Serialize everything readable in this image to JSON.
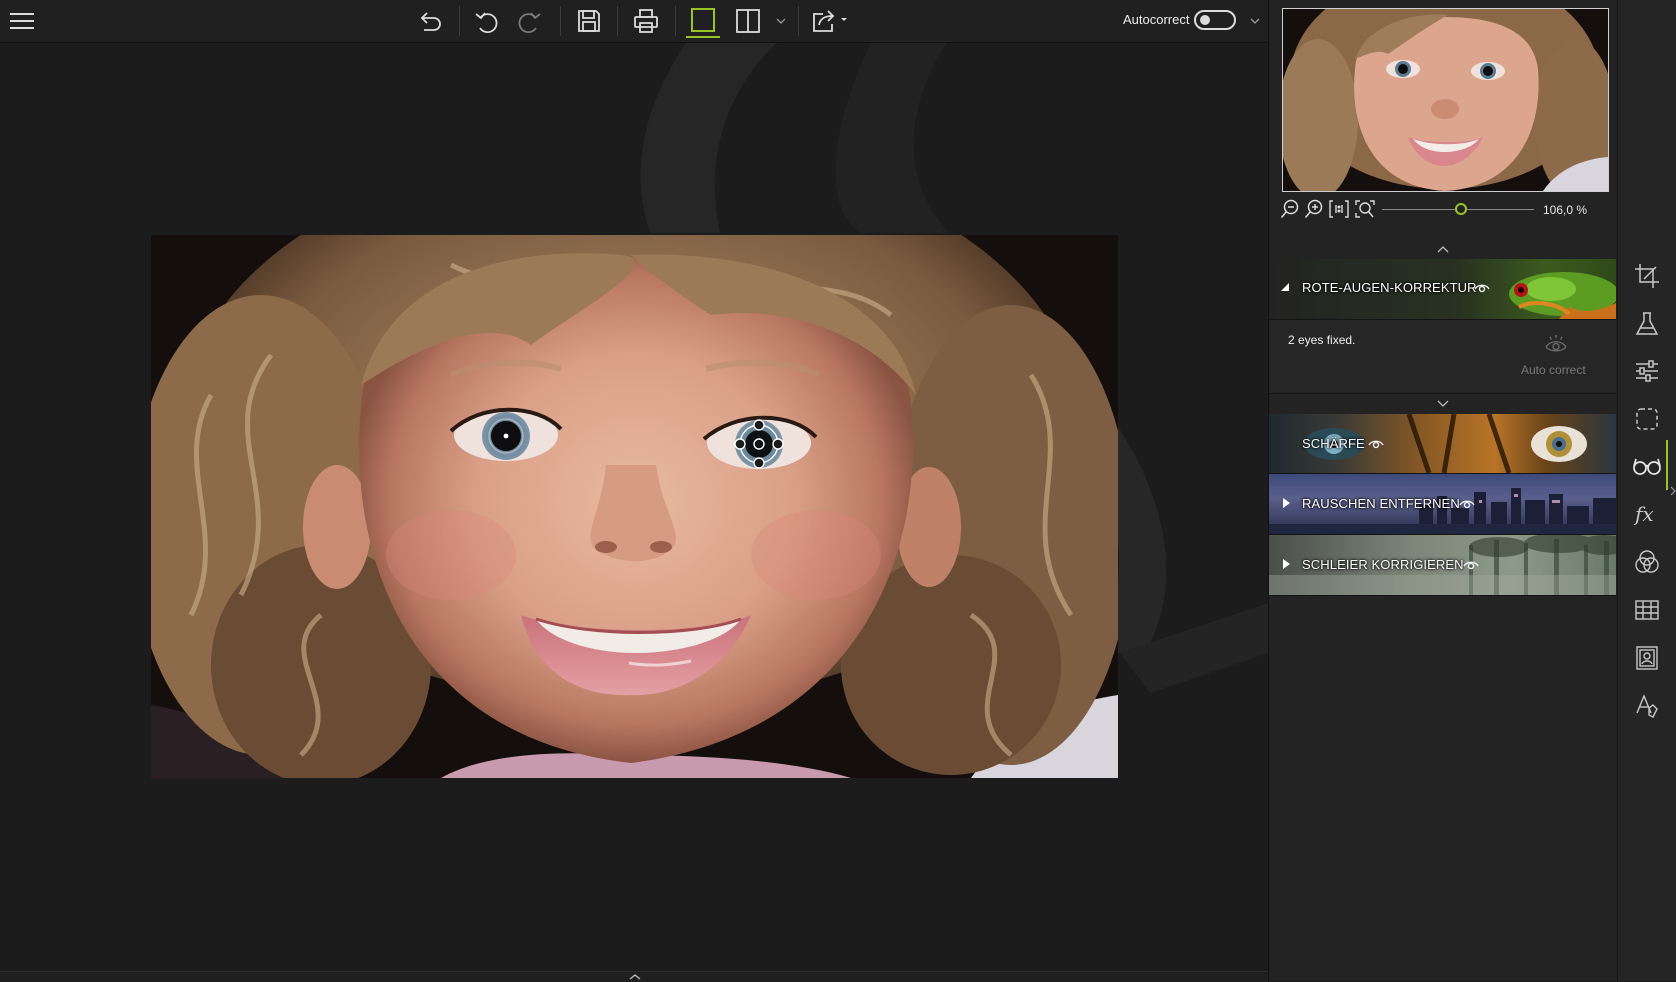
{
  "toolbar": {
    "autocorrect_label": "Autocorrect",
    "autocorrect_on": false,
    "items": [
      "menu-icon",
      "undo-all-icon",
      "undo-icon",
      "redo-icon",
      "save-icon",
      "print-icon",
      "single-view-icon",
      "split-view-icon",
      "dropdown-icon",
      "share-icon"
    ]
  },
  "navigator": {
    "zoom_value": "106,0 %",
    "zoom_fraction": 0.52
  },
  "sections": {
    "red_eye": {
      "title": "ROTE-AUGEN-KORREKTUR",
      "status": "2 eyes fixed.",
      "auto_correct_label": "Auto correct"
    },
    "sharpness": {
      "title": "SCHÄRFE"
    },
    "noise": {
      "title": "RAUSCHEN ENTFERNEN"
    },
    "haze": {
      "title": "SCHLEIER KORRIGIEREN"
    }
  },
  "tool_strip": [
    "crop-icon",
    "flask-icon",
    "adjust-sliders-icon",
    "selection-icon",
    "red-eye-glasses-icon",
    "fx-icon",
    "color-circles-icon",
    "texture-grid-icon",
    "portrait-frame-icon",
    "text-icon"
  ],
  "colors": {
    "accent": "#9bc22b",
    "panel": "#232323",
    "canvas": "#1c1c1c"
  }
}
